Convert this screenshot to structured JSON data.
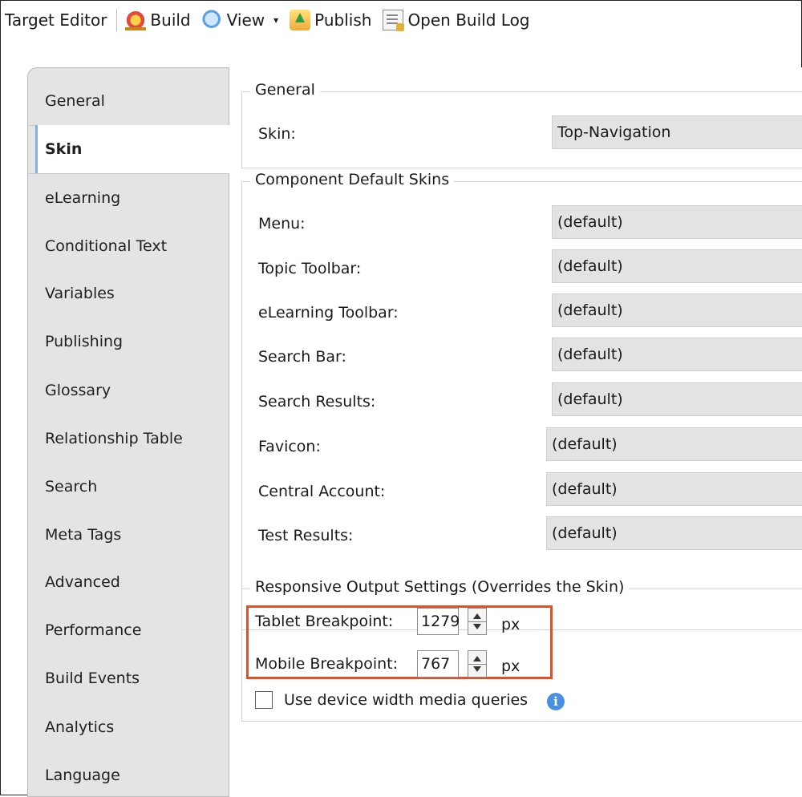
{
  "toolbar": {
    "title": "Target Editor",
    "buttons": [
      {
        "label": "Build",
        "icon": "build-icon"
      },
      {
        "label": "View",
        "icon": "view-icon",
        "caret": "▾"
      },
      {
        "label": "Publish",
        "icon": "publish-icon"
      },
      {
        "label": "Open Build Log",
        "icon": "build-log-icon"
      }
    ]
  },
  "tabs": [
    "General",
    "Skin",
    "eLearning",
    "Conditional Text",
    "Variables",
    "Publishing",
    "Glossary",
    "Relationship Table",
    "Search",
    "Meta Tags",
    "Advanced",
    "Performance",
    "Build Events",
    "Analytics",
    "Language"
  ],
  "active_tab": "Skin",
  "general_group": {
    "legend": "General",
    "skin_label": "Skin:",
    "skin_value": "Top-Navigation"
  },
  "component_group": {
    "legend": "Component Default Skins",
    "rows": [
      {
        "label": "Menu:",
        "value": "(default)"
      },
      {
        "label": "Topic Toolbar:",
        "value": "(default)"
      },
      {
        "label": "eLearning Toolbar:",
        "value": "(default)"
      },
      {
        "label": "Search Bar:",
        "value": "(default)"
      },
      {
        "label": "Search Results:",
        "value": "(default)"
      },
      {
        "label": "Favicon:",
        "value": "(default)"
      },
      {
        "label": "Central Account:",
        "value": "(default)"
      },
      {
        "label": "Test Results:",
        "value": "(default)"
      }
    ]
  },
  "responsive_group": {
    "legend": "Responsive Output Settings (Overrides the Skin)",
    "tablet_label": "Tablet Breakpoint:",
    "tablet_value": "1279",
    "mobile_label": "Mobile Breakpoint:",
    "mobile_value": "767",
    "unit": "px",
    "device_width_label": "Use device width media queries",
    "device_width_checked": false,
    "highlight_color": "#e0502a"
  }
}
